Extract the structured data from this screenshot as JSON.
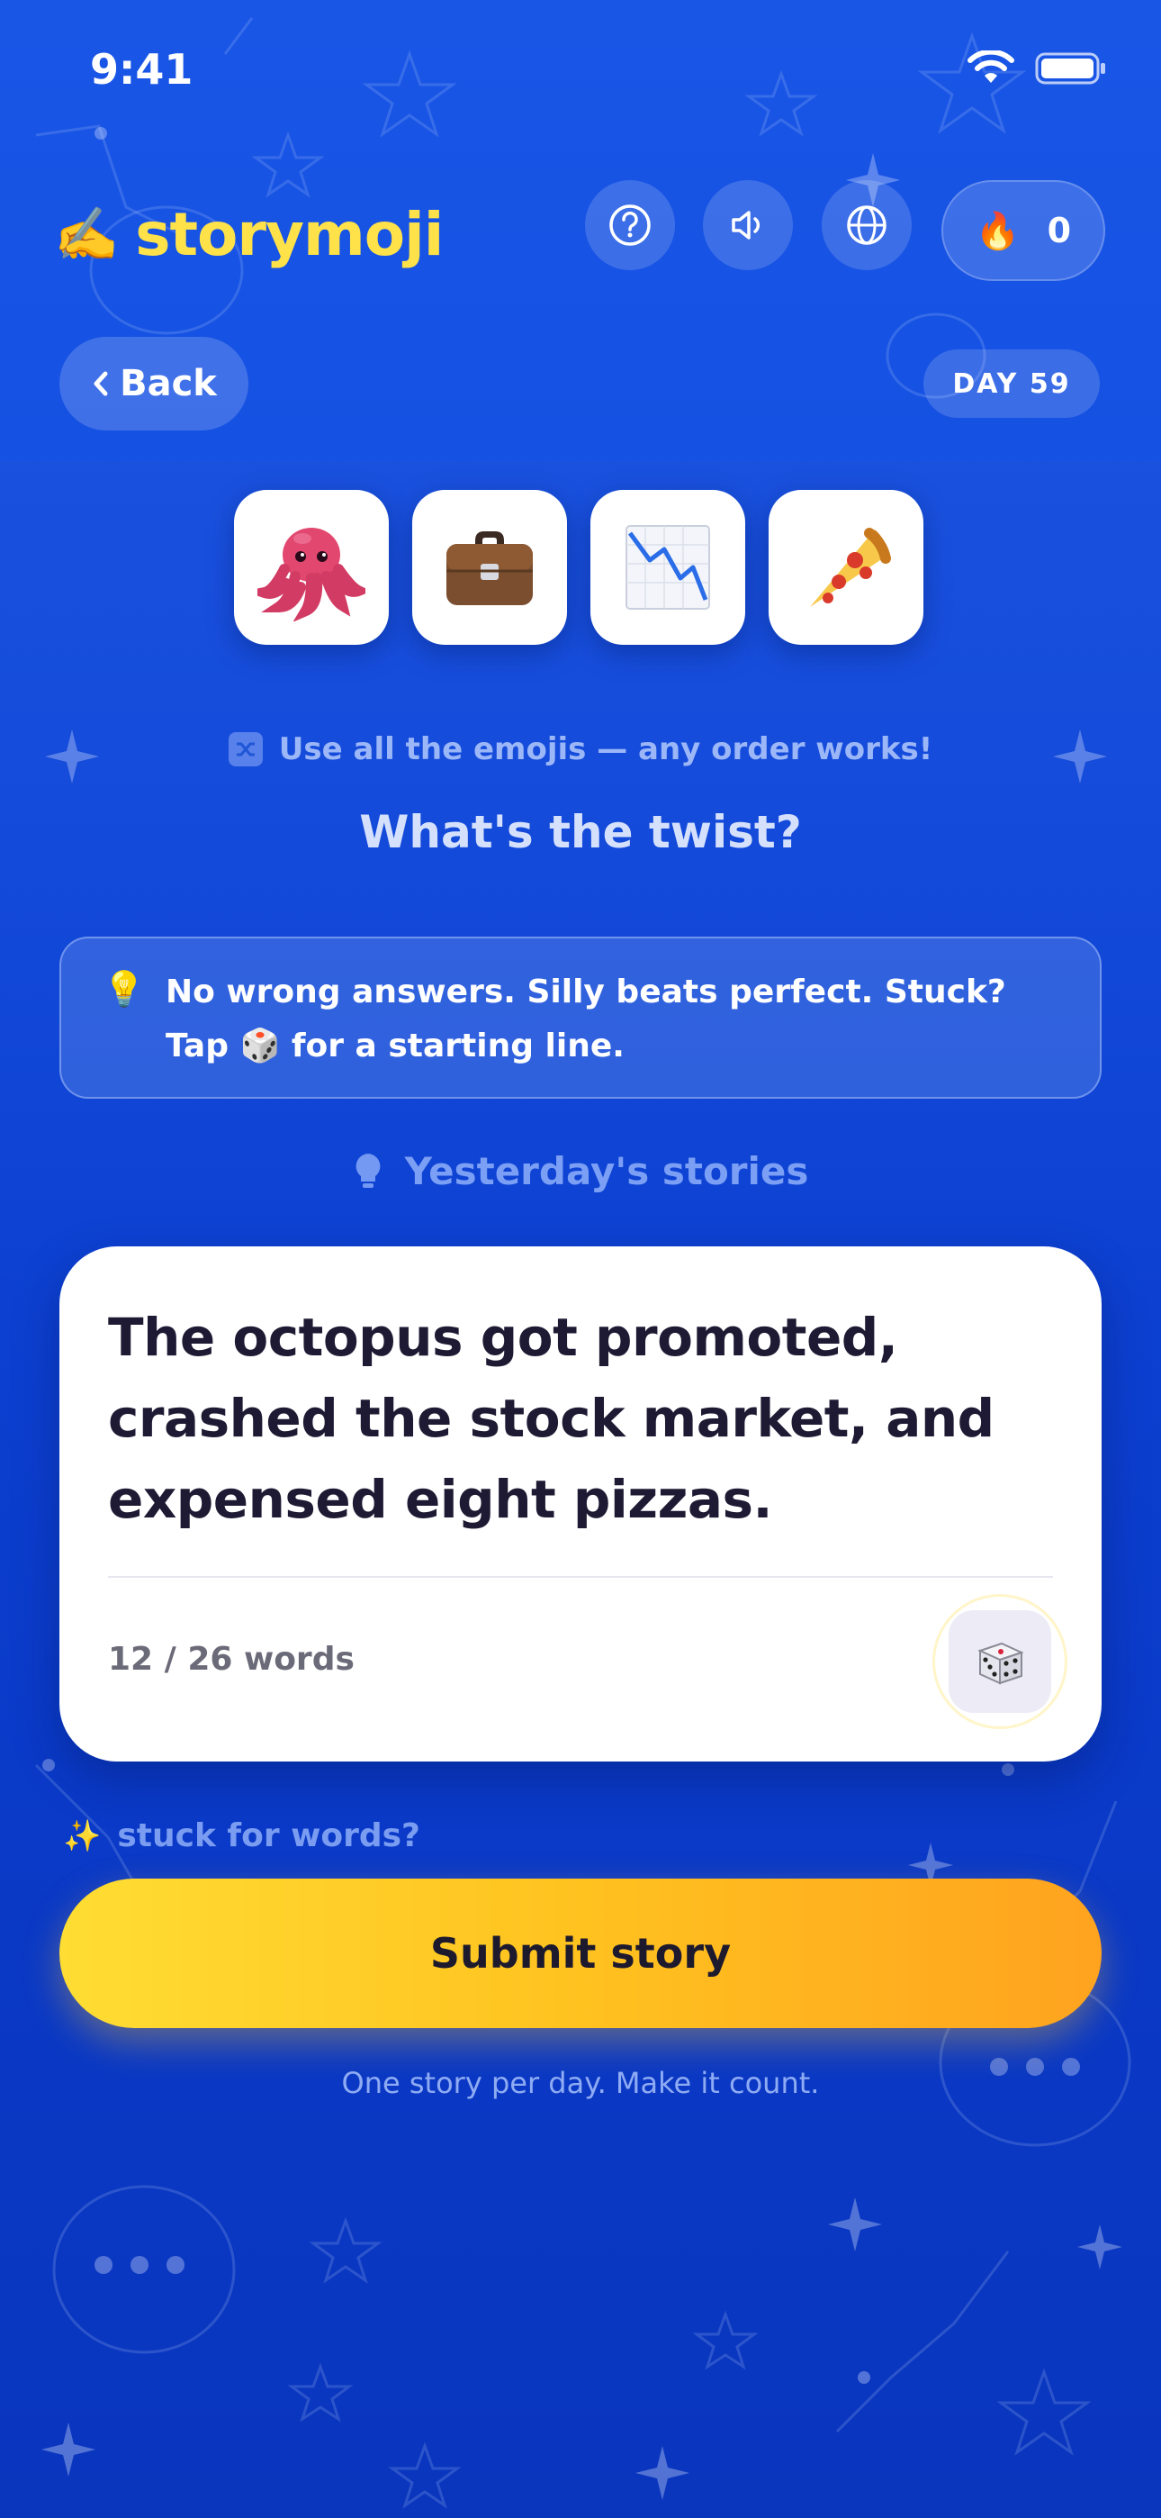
{
  "status_bar": {
    "time": "9:41"
  },
  "header": {
    "logo_emoji": "✍️",
    "app_name": "storymoji",
    "icons": [
      "help-icon",
      "speaker-icon",
      "globe-icon"
    ],
    "streak": {
      "icon": "🔥",
      "count": "0"
    }
  },
  "nav": {
    "back_label": "Back",
    "day_label": "DAY 59"
  },
  "prompt": {
    "emojis": [
      "🐙",
      "💼",
      "📉",
      "🍕"
    ],
    "hint": "Use all the emojis — any order works!",
    "question": "What's the twist?"
  },
  "tip": {
    "icon": "💡",
    "text": "No wrong answers. Silly beats perfect. Stuck? Tap 🎲 for a starting line."
  },
  "yesterday": {
    "label": "Yesterday's stories"
  },
  "story": {
    "text": "The octopus got promoted, crashed the stock market, and expensed eight pizzas.",
    "word_count": "12 / 26 words",
    "dice_icon": "🎲"
  },
  "stuck": {
    "icon": "✨",
    "label": "stuck for words?"
  },
  "submit": {
    "label": "Submit story"
  },
  "footer": {
    "note": "One story per day. Make it count."
  },
  "colors": {
    "background": "#1250e0",
    "logo": "#ffe24a",
    "submit_start": "#ffdd33",
    "submit_end": "#ffa31f"
  }
}
